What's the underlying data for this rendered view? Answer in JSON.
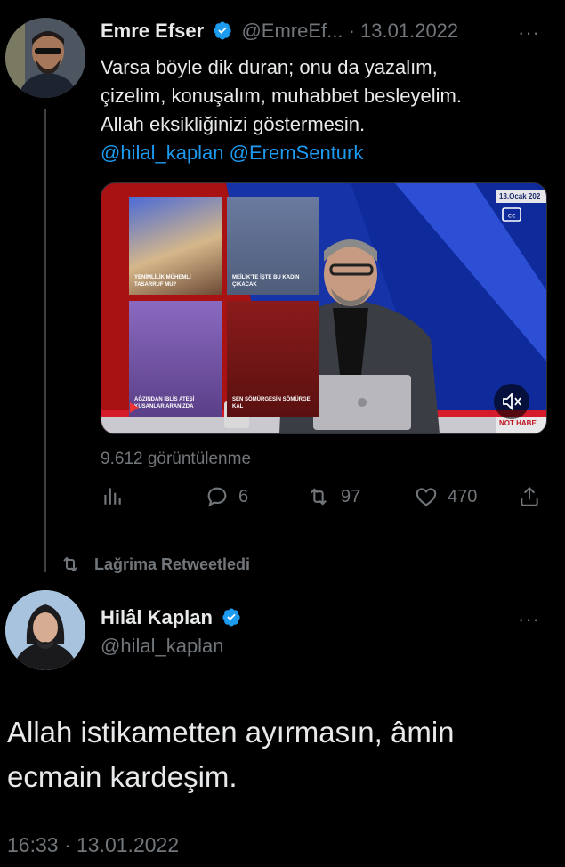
{
  "tweet1": {
    "name": "Emre Efser",
    "handle": "@EmreEf...",
    "separator": "·",
    "date": "13.01.2022",
    "more": "···",
    "text_lines": [
      "Varsa böyle dik duran; onu da yazalım,",
      "çizelim, konuşalım, muhabbet besleyelim.",
      "Allah eksikliğinizi göstermesin."
    ],
    "mentions": [
      "@hilal_kaplan",
      "@EremSenturk"
    ],
    "video": {
      "date_badge": "13.Ocak 202",
      "corner_logo": "NOT HABE",
      "tiles": [
        {
          "caption": "YENİMLİLİK MÜHEMLİ TASARRUF MU?"
        },
        {
          "caption": "MEİLİK'TE İŞTE BU KADIN ÇIKACAK"
        },
        {
          "caption": "AĞZINDAN İBLİS ATEŞİ KUSANLAR ARANIZDA"
        },
        {
          "caption": "SEN SÖMÜRGESİN SÖMÜRGE KAL"
        }
      ]
    },
    "views": "9.612 görüntülenme",
    "stats": {
      "replies": "6",
      "retweets": "97",
      "likes": "470"
    }
  },
  "retweet_label": "Lağrima Retweetledi",
  "tweet2": {
    "name": "Hilâl Kaplan",
    "handle": "@hilal_kaplan",
    "more": "···",
    "text_lines": [
      "Allah istikametten ayırmasın, âmin",
      "ecmain kardeşim."
    ],
    "timestamp": "16:33 · 13.01.2022"
  },
  "colors": {
    "accent": "#1d9bf0",
    "muted": "#71767b",
    "text": "#e7e9ea",
    "bg": "#000000"
  }
}
